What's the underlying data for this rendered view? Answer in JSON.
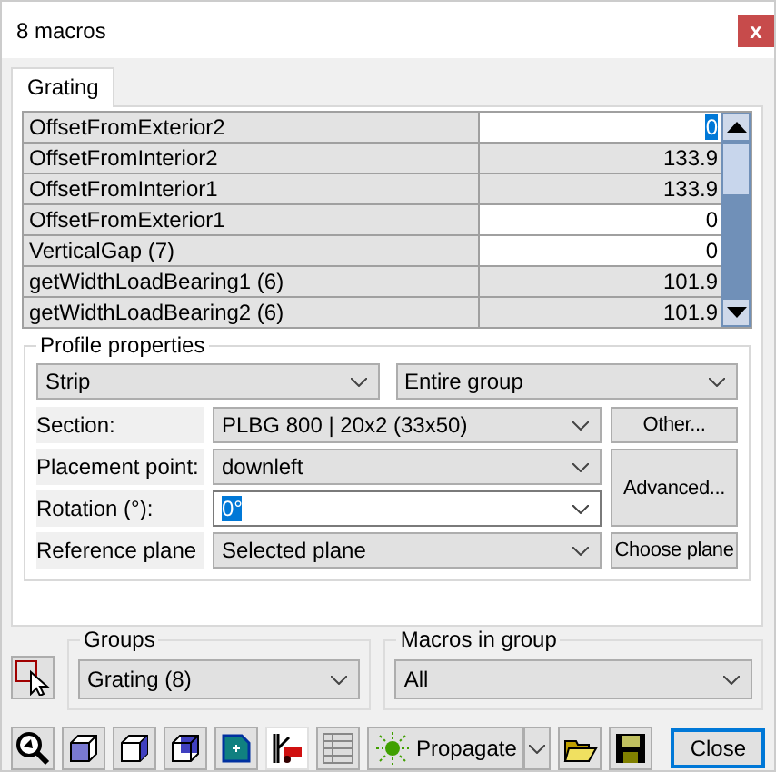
{
  "window": {
    "title": "8 macros",
    "close": "x"
  },
  "tabs": [
    {
      "label": "Grating",
      "selected": true
    }
  ],
  "properties": [
    {
      "name": "OffsetFromExterior2",
      "value": "0",
      "editable": true,
      "selected": true
    },
    {
      "name": "OffsetFromInterior2",
      "value": "133.9",
      "editable": false,
      "selected": false
    },
    {
      "name": "OffsetFromInterior1",
      "value": "133.9",
      "editable": false,
      "selected": false
    },
    {
      "name": "OffsetFromExterior1",
      "value": "0",
      "editable": true,
      "selected": false
    },
    {
      "name": "VerticalGap (7)",
      "value": "0",
      "editable": true,
      "selected": false
    },
    {
      "name": "getWidthLoadBearing1 (6)",
      "value": "101.9",
      "editable": false,
      "selected": false
    },
    {
      "name": "getWidthLoadBearing2 (6)",
      "value": "101.9",
      "editable": false,
      "selected": false
    }
  ],
  "profile_properties": {
    "title": "Profile properties",
    "type": "Strip",
    "scope": "Entire group",
    "fields": [
      {
        "label": "Section:",
        "value": "PLBG 800 | 20x2 (33x50)",
        "kind": "combo",
        "selected": false
      },
      {
        "label": "Placement point:",
        "value": "downleft",
        "kind": "combo",
        "selected": false
      },
      {
        "label": "Rotation (°):",
        "value": "0°",
        "kind": "editcombo",
        "selected": true
      },
      {
        "label": "Reference plane",
        "value": "Selected plane",
        "kind": "combo",
        "selected": false
      }
    ],
    "buttons": [
      "Other...",
      "Advanced...",
      "Choose plane"
    ]
  },
  "groups": {
    "label": "Groups",
    "value": "Grating (8)"
  },
  "macros_in_group": {
    "label": "Macros in group",
    "value": "All"
  },
  "toolbar": [
    {
      "kind": "zoom",
      "pressed": false
    },
    {
      "kind": "cube-front",
      "pressed": false
    },
    {
      "kind": "cube-side",
      "pressed": false
    },
    {
      "kind": "cube-back",
      "pressed": false
    },
    {
      "kind": "add-part",
      "pressed": false
    },
    {
      "kind": "crane",
      "pressed": true
    },
    {
      "kind": "table",
      "pressed": false
    }
  ],
  "propagate": "Propagate",
  "close_button": "Close"
}
